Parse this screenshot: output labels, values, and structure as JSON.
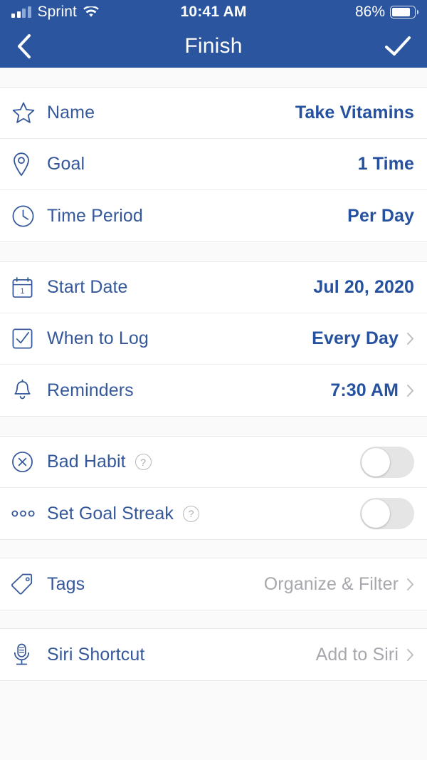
{
  "status_bar": {
    "carrier": "Sprint",
    "time": "10:41 AM",
    "battery_percent": "86%",
    "signal_icon": "cellular-signal-icon",
    "wifi_icon": "wifi-icon",
    "battery_icon": "battery-icon"
  },
  "nav_bar": {
    "title": "Finish",
    "back_icon": "chevron-left-icon",
    "confirm_icon": "checkmark-icon",
    "background": "#2b569f"
  },
  "colors": {
    "accent": "#2b569f",
    "label": "#35589b",
    "value": "#25519f",
    "muted": "#a7a7ad",
    "separator": "#ededf0",
    "page_background": "#fafafb"
  },
  "groups": [
    {
      "rows": [
        {
          "icon": "star-icon",
          "label": "Name",
          "value": "Take Vitamins",
          "value_style": "strong",
          "chevron": false
        },
        {
          "icon": "location-pin-icon",
          "label": "Goal",
          "value": "1 Time",
          "value_style": "strong",
          "chevron": false
        },
        {
          "icon": "clock-icon",
          "label": "Time Period",
          "value": "Per Day",
          "value_style": "strong",
          "chevron": false
        }
      ]
    },
    {
      "rows": [
        {
          "icon": "calendar-icon",
          "label": "Start Date",
          "value": "Jul 20, 2020",
          "value_style": "strong",
          "chevron": false
        },
        {
          "icon": "checkbox-checked-icon",
          "label": "When to Log",
          "value": "Every Day",
          "value_style": "strong",
          "chevron": true
        },
        {
          "icon": "bell-icon",
          "label": "Reminders",
          "value": "7:30 AM",
          "value_style": "strong",
          "chevron": true
        }
      ]
    },
    {
      "rows": [
        {
          "icon": "circle-x-icon",
          "label": "Bad Habit",
          "help": "?",
          "toggle": "off"
        },
        {
          "icon": "three-dots-icon",
          "label": "Set Goal Streak",
          "help": "?",
          "toggle": "off"
        }
      ]
    },
    {
      "rows": [
        {
          "icon": "tag-icon",
          "label": "Tags",
          "value": "Organize & Filter",
          "value_style": "muted",
          "chevron": true
        }
      ]
    },
    {
      "rows": [
        {
          "icon": "microphone-icon",
          "label": "Siri Shortcut",
          "value": "Add to Siri",
          "value_style": "muted",
          "chevron": true
        }
      ]
    }
  ]
}
